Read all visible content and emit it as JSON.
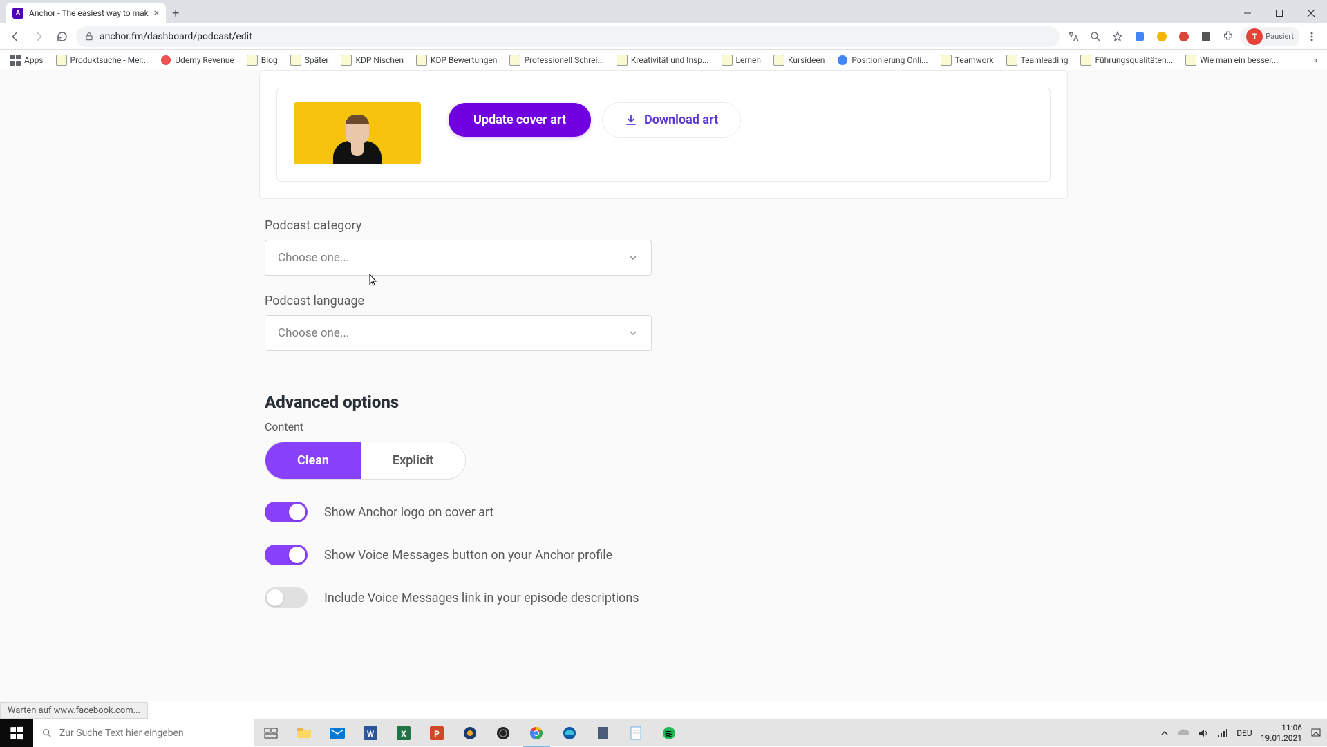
{
  "browser": {
    "tab_title": "Anchor - The easiest way to mak",
    "url": "anchor.fm/dashboard/podcast/edit",
    "apps_label": "Apps",
    "bookmarks": [
      "Produktsuche - Mer...",
      "Udemy Revenue",
      "Blog",
      "Später",
      "KDP Nischen",
      "KDP Bewertungen",
      "Professionell Schrei...",
      "Kreativität und Insp...",
      "Lernen",
      "Kursideen",
      "Positionierung Onli...",
      "Teamwork",
      "Teamleading",
      "Führungsqualitäten...",
      "Wie man ein besser..."
    ],
    "profile_status": "Pausiert"
  },
  "page": {
    "update_cover": "Update cover art",
    "download_art": "Download art",
    "category_label": "Podcast category",
    "category_placeholder": "Choose one...",
    "language_label": "Podcast language",
    "language_placeholder": "Choose one...",
    "advanced_heading": "Advanced options",
    "content_label": "Content",
    "seg_clean": "Clean",
    "seg_explicit": "Explicit",
    "toggles": [
      {
        "label": "Show Anchor logo on cover art",
        "on": true
      },
      {
        "label": "Show Voice Messages button on your Anchor profile",
        "on": true
      },
      {
        "label": "Include Voice Messages link in your episode descriptions",
        "on": false
      }
    ],
    "status_text": "Warten auf www.facebook.com..."
  },
  "taskbar": {
    "search_placeholder": "Zur Suche Text hier eingeben",
    "lang": "DEU",
    "time": "11:06",
    "date": "19.01.2021"
  },
  "colors": {
    "accent": "#8940fa",
    "primary": "#7000e0"
  }
}
